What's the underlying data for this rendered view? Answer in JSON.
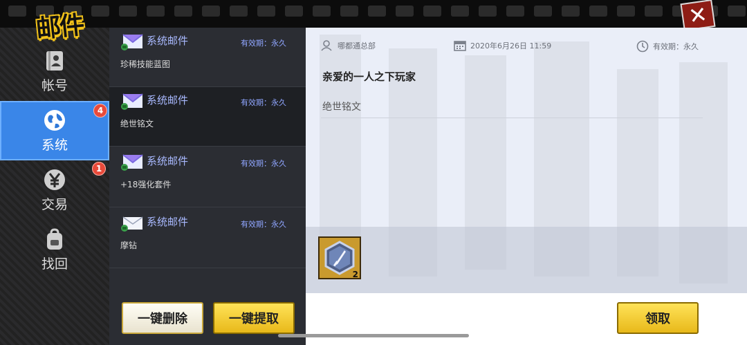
{
  "window": {
    "title": "邮件",
    "close_icon": "close-icon"
  },
  "nav": {
    "items": [
      {
        "label": "帐号",
        "icon": "account-book-icon",
        "badge": ""
      },
      {
        "label": "系统",
        "icon": "globe-icon",
        "badge": "4"
      },
      {
        "label": "交易",
        "icon": "yen-coin-icon",
        "badge": "1"
      },
      {
        "label": "找回",
        "icon": "backpack-icon",
        "badge": ""
      }
    ],
    "active_index": 1
  },
  "mail_list": [
    {
      "sender": "系统邮件",
      "validity": "有效期：永久",
      "subject": "珍稀技能蓝图",
      "read": false
    },
    {
      "sender": "系统邮件",
      "validity": "有效期：永久",
      "subject": "绝世铭文",
      "read": false
    },
    {
      "sender": "系统邮件",
      "validity": "有效期：永久",
      "subject": "+18强化套件",
      "read": false
    },
    {
      "sender": "系统邮件",
      "validity": "有效期：永久",
      "subject": "摩钻",
      "read": true
    }
  ],
  "list_buttons": {
    "delete_all": "一键删除",
    "claim_all": "一键提取"
  },
  "detail": {
    "sender": "哪都通总部",
    "date": "2020年6月26日 11:59",
    "validity": "有效期：永久",
    "greeting": "亲爱的一人之下玩家",
    "body": "绝世铭文",
    "attachment": {
      "icon": "engraving-item-icon",
      "quantity": "2"
    },
    "claim_label": "领取"
  },
  "colors": {
    "accent_yellow": "#f2c21a",
    "active_blue": "#3a86e8",
    "badge_red": "#e84a3a",
    "sender_blue": "#a9b9ff"
  }
}
